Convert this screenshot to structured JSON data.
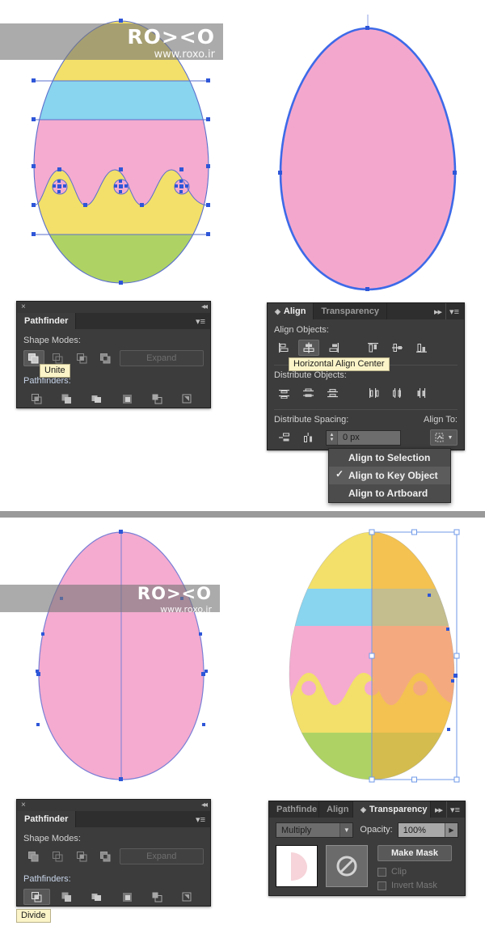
{
  "app": "Adobe Illustrator",
  "watermark": {
    "brand": "RO><O",
    "url": "www.roxo.ir"
  },
  "panels": {
    "pathfinder_top": {
      "tab": "Pathfinder",
      "shape_modes_label": "Shape Modes:",
      "pathfinders_label": "Pathfinders:",
      "expand_label": "Expand",
      "tooltip": "Unite",
      "shape_mode_buttons": [
        "Unite",
        "Minus Front",
        "Intersect",
        "Exclude"
      ],
      "pathfinder_buttons": [
        "Divide",
        "Trim",
        "Merge",
        "Crop",
        "Outline",
        "Minus Back"
      ],
      "selected_shape_mode": "Unite",
      "close_glyph": "×",
      "collapse_glyph": "◂◂",
      "menu_glyph": "▾≡"
    },
    "align": {
      "tabs": [
        {
          "label": "Align",
          "active": true
        },
        {
          "label": "Transparency",
          "active": false
        }
      ],
      "align_objects_label": "Align Objects:",
      "distribute_objects_label": "Distribute Objects:",
      "distribute_spacing_label": "Distribute Spacing:",
      "align_to_label": "Align To:",
      "spacing_value": "0 px",
      "tooltip": "Horizontal Align Center",
      "align_object_buttons": [
        "Horizontal Align Left",
        "Horizontal Align Center",
        "Horizontal Align Right",
        "Vertical Align Top",
        "Vertical Align Center",
        "Vertical Align Bottom"
      ],
      "selected_align_button": "Horizontal Align Center",
      "distribute_buttons": [
        "Vertical Distribute Top",
        "Vertical Distribute Center",
        "Vertical Distribute Bottom",
        "Horizontal Distribute Left",
        "Horizontal Distribute Center",
        "Horizontal Distribute Right"
      ],
      "spacing_buttons": [
        "Vertical Distribute Space",
        "Horizontal Distribute Space"
      ],
      "dropdown": {
        "items": [
          {
            "label": "Align to Selection",
            "checked": false
          },
          {
            "label": "Align to Key Object",
            "checked": true
          },
          {
            "label": "Align to Artboard",
            "checked": false
          }
        ],
        "check_glyph": "✓"
      },
      "expand_glyph": "▸▸",
      "menu_glyph": "▾≡"
    },
    "pathfinder_bottom": {
      "tab": "Pathfinder",
      "shape_modes_label": "Shape Modes:",
      "pathfinders_label": "Pathfinders:",
      "expand_label": "Expand",
      "tooltip": "Divide",
      "selected_pathfinder": "Divide",
      "close_glyph": "×",
      "collapse_glyph": "◂◂",
      "menu_glyph": "▾≡"
    },
    "transparency": {
      "tabs": [
        {
          "label": "Pathfinde",
          "active": false
        },
        {
          "label": "Align",
          "active": false
        },
        {
          "label": "Transparency",
          "active": true
        }
      ],
      "blend_mode": "Multiply",
      "opacity_label": "Opacity:",
      "opacity_value": "100%",
      "make_mask_label": "Make Mask",
      "clip_label": "Clip",
      "invert_mask_label": "Invert Mask",
      "expand_glyph": "▸▸",
      "menu_glyph": "▾≡",
      "no_mask_glyph": "⊘"
    }
  },
  "artwork": {
    "colors": {
      "yellow": "#f2e06a",
      "blue": "#89d4ef",
      "pink": "#f4abcf",
      "green": "#aed364",
      "pink_solid": "#f4a7cd",
      "outline": "#2e56d8",
      "guide": "#7f8fdb",
      "selection": "#6f9ae8",
      "multiply_orange": "#f5b944"
    },
    "eggs": [
      {
        "id": "egg-striped-outlined",
        "label": "Striped egg with path anchors"
      },
      {
        "id": "egg-pink-plain",
        "label": "Plain pink egg selected"
      },
      {
        "id": "egg-pink-divide",
        "label": "Pink egg with vertical divide path"
      },
      {
        "id": "egg-multiply",
        "label": "Striped egg with multiply overlay"
      }
    ]
  }
}
